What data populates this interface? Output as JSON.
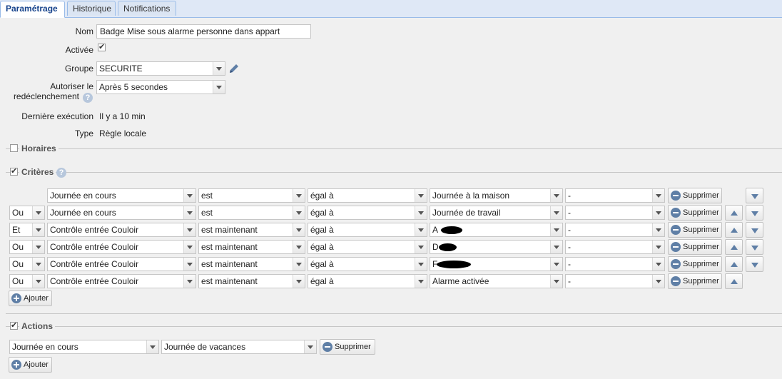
{
  "tabs": [
    {
      "label": "Paramétrage",
      "active": true
    },
    {
      "label": "Historique",
      "active": false
    },
    {
      "label": "Notifications",
      "active": false
    }
  ],
  "form": {
    "nom_label": "Nom",
    "nom_value": "Badge Mise sous alarme personne dans appart",
    "activee_label": "Activée",
    "activee_checked": true,
    "groupe_label": "Groupe",
    "groupe_value": "SECURITE",
    "autoriser_label_1": "Autoriser le",
    "autoriser_label_2": "redéclenchement",
    "autoriser_value": "Après 5 secondes",
    "derniere_label": "Dernière exécution",
    "derniere_value": "Il y a 10 min",
    "type_label": "Type",
    "type_value": "Règle locale"
  },
  "horaires": {
    "title": "Horaires",
    "checked": false
  },
  "criteres": {
    "title": "Critères",
    "checked": true,
    "rows": [
      {
        "op": "",
        "source": "Journée en cours",
        "cond": "est",
        "comp": "égal à",
        "value": "Journée à la maison",
        "extra": "-",
        "delete": "Supprimer",
        "up": false,
        "down": true
      },
      {
        "op": "Ou",
        "source": "Journée en cours",
        "cond": "est",
        "comp": "égal à",
        "value": "Journée de travail",
        "extra": "-",
        "delete": "Supprimer",
        "up": true,
        "down": true
      },
      {
        "op": "Et",
        "source": "Contrôle entrée Couloir",
        "cond": "est maintenant",
        "comp": "égal à",
        "value": "A",
        "extra": "-",
        "delete": "Supprimer",
        "up": true,
        "down": true
      },
      {
        "op": "Ou",
        "source": "Contrôle entrée Couloir",
        "cond": "est maintenant",
        "comp": "égal à",
        "value": "D",
        "extra": "-",
        "delete": "Supprimer",
        "up": true,
        "down": true
      },
      {
        "op": "Ou",
        "source": "Contrôle entrée Couloir",
        "cond": "est maintenant",
        "comp": "égal à",
        "value": "F",
        "extra": "-",
        "delete": "Supprimer",
        "up": true,
        "down": true
      },
      {
        "op": "Ou",
        "source": "Contrôle entrée Couloir",
        "cond": "est maintenant",
        "comp": "égal à",
        "value": "Alarme activée",
        "extra": "-",
        "delete": "Supprimer",
        "up": true,
        "down": false
      }
    ],
    "add_label": "Ajouter"
  },
  "actions": {
    "title": "Actions",
    "checked": true,
    "rows": [
      {
        "source": "Journée en cours",
        "value": "Journée de vacances",
        "delete": "Supprimer"
      }
    ],
    "add_label": "Ajouter"
  }
}
